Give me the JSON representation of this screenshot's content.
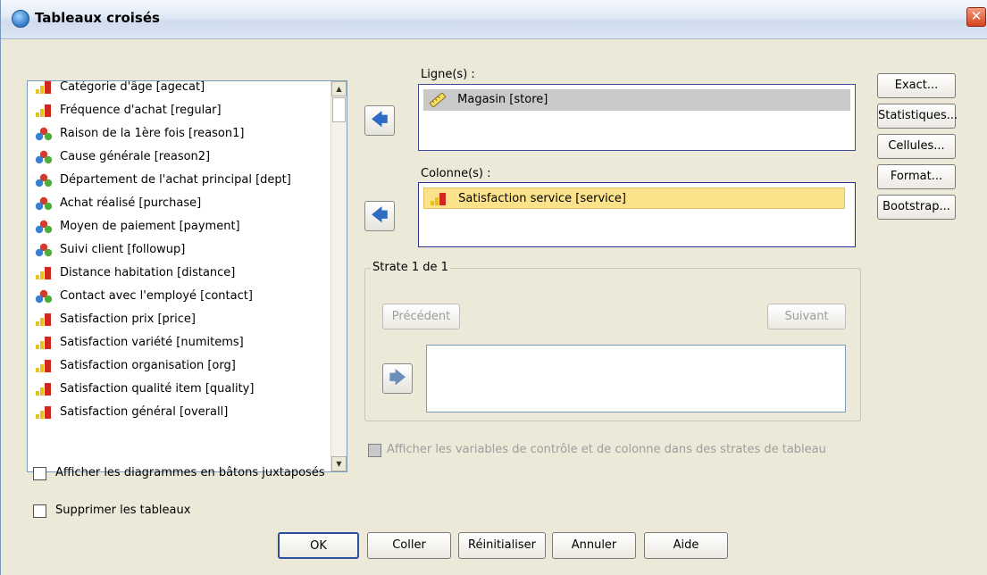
{
  "window": {
    "title": "Tableaux croisés",
    "close_glyph": "✕"
  },
  "variables": [
    {
      "label": "Catégorie d'âge [agecat]",
      "icon": "ordinal-bar-icon"
    },
    {
      "label": "Fréquence d'achat [regular]",
      "icon": "ordinal-bar-icon"
    },
    {
      "label": "Raison de la 1ère fois [reason1]",
      "icon": "nominal-circles-icon"
    },
    {
      "label": "Cause générale [reason2]",
      "icon": "nominal-circles-icon"
    },
    {
      "label": "Département de l'achat principal [dept]",
      "icon": "nominal-circles-icon"
    },
    {
      "label": "Achat réalisé [purchase]",
      "icon": "nominal-circles-icon"
    },
    {
      "label": "Moyen de paiement [payment]",
      "icon": "nominal-circles-icon"
    },
    {
      "label": "Suivi client [followup]",
      "icon": "nominal-circles-icon"
    },
    {
      "label": "Distance habitation [distance]",
      "icon": "ordinal-bar-icon"
    },
    {
      "label": "Contact avec l'employé [contact]",
      "icon": "nominal-circles-icon"
    },
    {
      "label": "Satisfaction prix [price]",
      "icon": "ordinal-bar-icon"
    },
    {
      "label": "Satisfaction variété [numitems]",
      "icon": "ordinal-bar-icon"
    },
    {
      "label": "Satisfaction organisation [org]",
      "icon": "ordinal-bar-icon"
    },
    {
      "label": "Satisfaction qualité item [quality]",
      "icon": "ordinal-bar-icon"
    },
    {
      "label": "Satisfaction général [overall]",
      "icon": "ordinal-bar-icon"
    }
  ],
  "rows": {
    "label": "Ligne(s) :",
    "items": [
      {
        "label": "Magasin [store]",
        "icon": "scale-ruler-icon"
      }
    ]
  },
  "columns": {
    "label": "Colonne(s) :",
    "items": [
      {
        "label": "Satisfaction service [service]",
        "icon": "ordinal-bar-icon"
      }
    ]
  },
  "layer": {
    "title": "Strate 1 de 1",
    "previous": "Précédent",
    "next": "Suivant"
  },
  "side_buttons": [
    "Exact...",
    "Statistiques...",
    "Cellules...",
    "Format...",
    "Bootstrap..."
  ],
  "options": {
    "display_layer": "Afficher les variables de contrôle et de colonne dans des strates de tableau",
    "clustered_bar": "Afficher les diagrammes en bâtons juxtaposés",
    "suppress_tables": "Supprimer les tableaux"
  },
  "footer": {
    "ok": "OK",
    "paste": "Coller",
    "reset": "Réinitialiser",
    "cancel": "Annuler",
    "help": "Aide"
  },
  "glyphs": {
    "arrow_left": "🡄",
    "arrow_right": "🡆",
    "scroll_up": "▲",
    "scroll_down": "▼"
  }
}
